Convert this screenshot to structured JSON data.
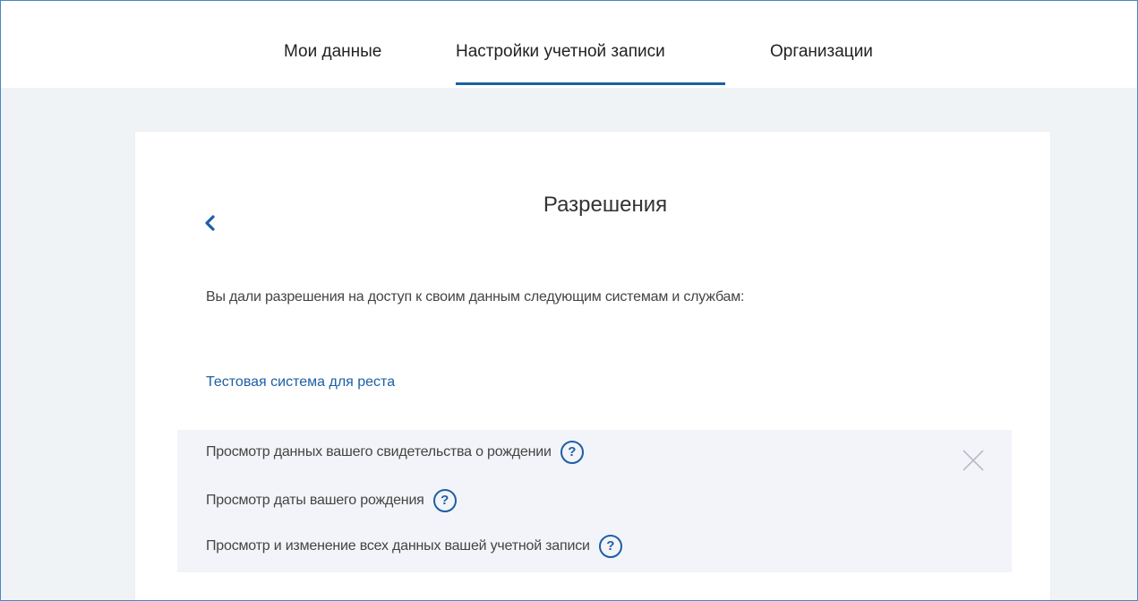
{
  "nav": {
    "tabs": [
      {
        "label": "Мои данные"
      },
      {
        "label": "Настройки учетной записи",
        "active": true
      },
      {
        "label": "Организации"
      }
    ]
  },
  "card": {
    "title": "Разрешения",
    "intro": "Вы дали разрешения на доступ к своим данным следующим системам и службам:",
    "systems": [
      {
        "name": "Тестовая система для реста",
        "permissions": [
          {
            "label": "Просмотр данных вашего свидетельства о рождении"
          },
          {
            "label": "Просмотр даты вашего рождения"
          },
          {
            "label": "Просмотр и изменение всех данных вашей учетной записи"
          }
        ]
      }
    ]
  },
  "icons": {
    "back": "chevron-left-icon",
    "help": "question-circle-icon",
    "revoke": "close-icon",
    "help_glyph": "?"
  },
  "colors": {
    "accent": "#1d5fa6",
    "page_bg": "#f0f3f5",
    "perm_bg": "#f3f4f9",
    "frame_border": "#4a86c5"
  }
}
